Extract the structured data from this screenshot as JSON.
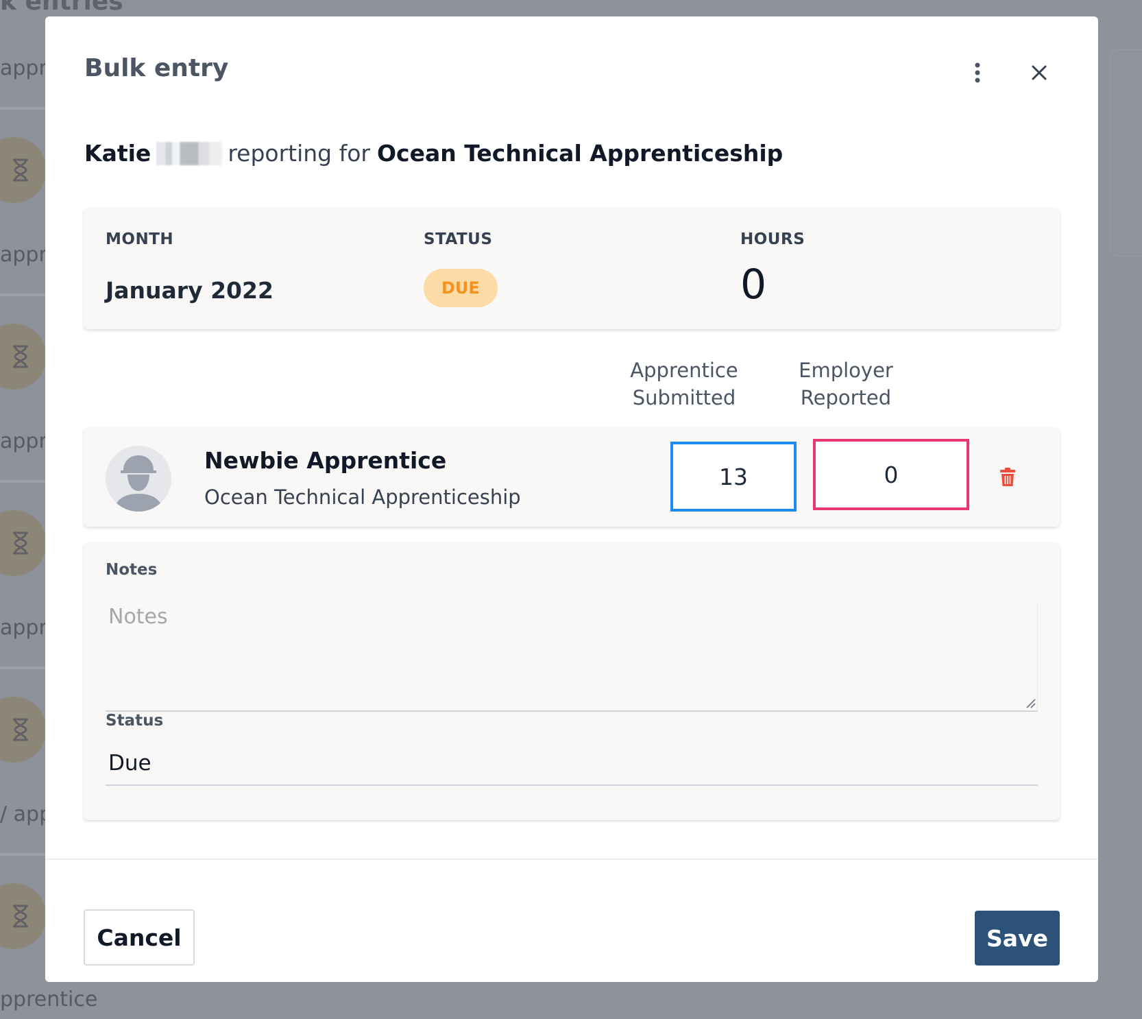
{
  "background": {
    "heading": "k entries",
    "row_labels": [
      "appre",
      "appre",
      "appre",
      "appr",
      "/ app"
    ],
    "bottom_label": "pprentice"
  },
  "modal": {
    "title": "Bulk entry",
    "subtitle": {
      "first_name": "Katie",
      "middle": "reporting for",
      "program": "Ocean Technical Apprenticeship"
    },
    "summary": {
      "month_label": "MONTH",
      "month_value": "January 2022",
      "status_label": "STATUS",
      "status_value": "DUE",
      "hours_label": "HOURS",
      "hours_value": "0"
    },
    "columns": {
      "apprentice": "Apprentice Submitted",
      "employer": "Employer Reported"
    },
    "entry": {
      "name": "Newbie Apprentice",
      "program": "Ocean Technical Apprenticeship",
      "apprentice_hours": "13",
      "employer_hours": "0"
    },
    "form": {
      "notes_label": "Notes",
      "notes_placeholder": "Notes",
      "status_label": "Status",
      "status_value": "Due"
    },
    "footer": {
      "cancel_label": "Cancel",
      "save_label": "Save"
    }
  },
  "colors": {
    "overlay": "#8d929b",
    "badge_bg": "#fddba6",
    "badge_text": "#f39322",
    "apprentice_border": "#1d8cf1",
    "employer_border": "#ec3870",
    "trash": "#ef4d3c",
    "save_bg": "#2c527a"
  },
  "icons": [
    "hourglass-icon",
    "kebab-menu-icon",
    "close-icon",
    "avatar-icon",
    "trash-icon",
    "resize-grip-icon"
  ]
}
